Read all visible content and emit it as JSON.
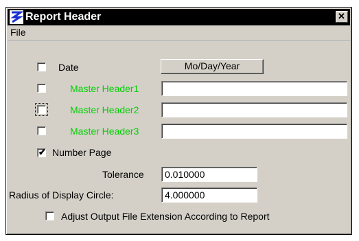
{
  "window": {
    "title": "Report Header",
    "close_icon": "close-icon",
    "app_icon": "app-logo-icon"
  },
  "menubar": {
    "file": "File"
  },
  "date": {
    "label": "Date",
    "checked": false,
    "format_button": "Mo/Day/Year"
  },
  "headers": [
    {
      "label": "Master Header1",
      "value": "",
      "checked": false
    },
    {
      "label": "Master Header2",
      "value": "",
      "checked": false
    },
    {
      "label": "Master Header3",
      "value": "",
      "checked": false
    }
  ],
  "number_page": {
    "label": "Number Page",
    "checked": true
  },
  "tolerance": {
    "label": "Tolerance",
    "value": "0.010000"
  },
  "radius": {
    "label": "Radius of Display Circle:",
    "value": "4.000000"
  },
  "adjust": {
    "label": "Adjust Output File Extension According to Report",
    "checked": false
  },
  "colors": {
    "header_label": "#00d000",
    "title_bar": "#000000",
    "dialog_bg": "#d4d0c8"
  }
}
